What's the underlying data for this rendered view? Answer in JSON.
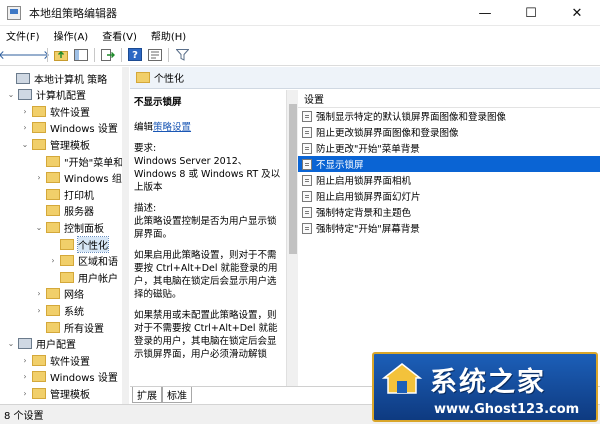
{
  "window": {
    "title": "本地组策略编辑器",
    "controls": [
      "—",
      "☐",
      "✕"
    ]
  },
  "menu": [
    "文件(F)",
    "操作(A)",
    "查看(V)",
    "帮助(H)"
  ],
  "toolbar_icons": [
    "back-arrow-icon",
    "forward-arrow-icon",
    "folder-up-icon",
    "show-tree-icon",
    "export-icon",
    "help-icon",
    "properties-icon",
    "filter-icon"
  ],
  "tree": [
    {
      "label": "本地计算机 策略",
      "level": 0,
      "expander": "",
      "icon": "computer"
    },
    {
      "label": "计算机配置",
      "level": 1,
      "expander": "⌄",
      "icon": "computer"
    },
    {
      "label": "软件设置",
      "level": 2,
      "expander": "›",
      "icon": "folder"
    },
    {
      "label": "Windows 设置",
      "level": 2,
      "expander": "›",
      "icon": "folder"
    },
    {
      "label": "管理模板",
      "level": 2,
      "expander": "⌄",
      "icon": "folder"
    },
    {
      "label": "\"开始\"菜单和",
      "level": 3,
      "expander": "",
      "icon": "folder"
    },
    {
      "label": "Windows 组",
      "level": 3,
      "expander": "›",
      "icon": "folder"
    },
    {
      "label": "打印机",
      "level": 3,
      "expander": "",
      "icon": "folder"
    },
    {
      "label": "服务器",
      "level": 3,
      "expander": "",
      "icon": "folder"
    },
    {
      "label": "控制面板",
      "level": 3,
      "expander": "⌄",
      "icon": "folder"
    },
    {
      "label": "个性化",
      "level": 4,
      "expander": "",
      "icon": "folder",
      "selected": true
    },
    {
      "label": "区域和语",
      "level": 4,
      "expander": "›",
      "icon": "folder"
    },
    {
      "label": "用户帐户",
      "level": 4,
      "expander": "",
      "icon": "folder"
    },
    {
      "label": "网络",
      "level": 3,
      "expander": "›",
      "icon": "folder"
    },
    {
      "label": "系统",
      "level": 3,
      "expander": "›",
      "icon": "folder"
    },
    {
      "label": "所有设置",
      "level": 3,
      "expander": "",
      "icon": "folder"
    },
    {
      "label": "用户配置",
      "level": 1,
      "expander": "⌄",
      "icon": "computer"
    },
    {
      "label": "软件设置",
      "level": 2,
      "expander": "›",
      "icon": "folder"
    },
    {
      "label": "Windows 设置",
      "level": 2,
      "expander": "›",
      "icon": "folder"
    },
    {
      "label": "管理模板",
      "level": 2,
      "expander": "›",
      "icon": "folder"
    }
  ],
  "header": {
    "title": "个性化"
  },
  "description": {
    "policy_title": "不显示锁屏",
    "edit_prefix": "编辑",
    "edit_link": "策略设置",
    "requirement_label": "要求:",
    "requirement_text": "Windows Server 2012、Windows 8 或 Windows RT 及以上版本",
    "desc_label": "描述:",
    "desc_text": "此策略设置控制是否为用户显示锁屏界面。",
    "para_enabled": "如果启用此策略设置，则对于不需要按 Ctrl+Alt+Del 就能登录的用户，其电脑在锁定后会显示用户选择的磁贴。",
    "para_disabled": "如果禁用或未配置此策略设置，则对于不需要按 Ctrl+Alt+Del 就能登录的用户，其电脑在锁定后会显示锁屏界面，用户必须滑动解锁"
  },
  "settings": {
    "column_header": "设置",
    "rows": [
      "强制显示特定的默认锁屏界面图像和登录图像",
      "阻止更改锁屏界面图像和登录图像",
      "防止更改\"开始\"菜单背景",
      "不显示锁屏",
      "阻止启用锁屏界面相机",
      "阻止启用锁屏界面幻灯片",
      "强制特定背景和主题色",
      "强制特定\"开始\"屏幕背景"
    ],
    "selected_index": 3
  },
  "tabs": [
    "扩展",
    "标准"
  ],
  "status": {
    "text": "8 个设置"
  },
  "watermark": {
    "name": "系统之家",
    "url": "www.Ghost123.com"
  }
}
